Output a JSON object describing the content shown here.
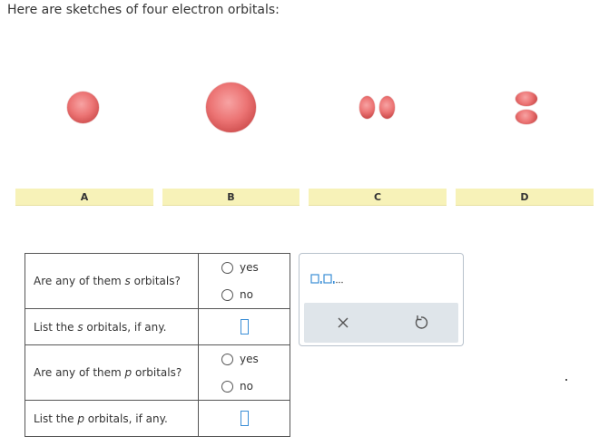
{
  "intro_text": "Here are sketches of four electron orbitals:",
  "labels": {
    "a": "A",
    "b": "B",
    "c": "C",
    "d": "D"
  },
  "questions": {
    "q1": {
      "text_before": "Are any of them ",
      "italic": "s",
      "text_after": " orbitals?",
      "options": [
        "yes",
        "no"
      ]
    },
    "q2": {
      "text_before": "List the ",
      "italic": "s",
      "text_after": " orbitals, if any."
    },
    "q3": {
      "text_before": "Are any of them ",
      "italic": "p",
      "text_after": " orbitals?",
      "options": [
        "yes",
        "no"
      ]
    },
    "q4": {
      "text_before": "List the ",
      "italic": "p",
      "text_after": " orbitals, if any."
    }
  },
  "tool_panel": {
    "template_label": "□,□,...",
    "clear_icon": "x-icon",
    "undo_icon": "undo-icon"
  },
  "colors": {
    "orbital": "#e57373",
    "label_bar": "#f7f2b8",
    "input_border": "#3a8ed6"
  }
}
